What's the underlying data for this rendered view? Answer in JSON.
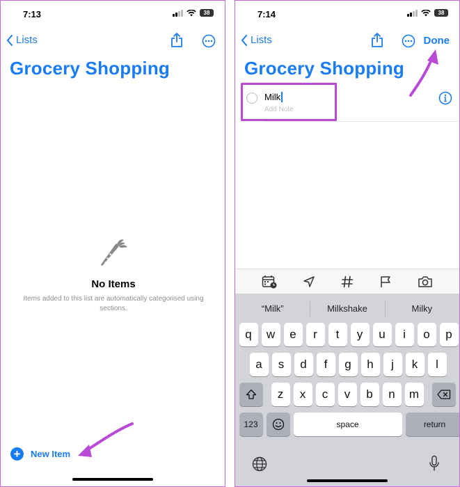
{
  "left": {
    "status_time": "7:13",
    "battery": "38",
    "back_label": "Lists",
    "title": "Grocery Shopping",
    "empty_title": "No Items",
    "empty_subtitle": "Items added to this list are automatically categorised using sections.",
    "new_item_label": "New Item",
    "icons": [
      "chevron-left-icon",
      "share-icon",
      "more-icon",
      "carrot-icon",
      "plus-icon"
    ]
  },
  "right": {
    "status_time": "7:14",
    "battery": "38",
    "back_label": "Lists",
    "done_label": "Done",
    "title": "Grocery Shopping",
    "item_text": "Milk",
    "item_note_placeholder": "Add Note",
    "toolbar_icons": [
      "calendar-clock-icon",
      "location-icon",
      "tag-icon",
      "flag-icon",
      "camera-icon"
    ],
    "suggestions": [
      "“Milk”",
      "Milkshake",
      "Milky"
    ],
    "keyboard": {
      "row1": [
        "q",
        "w",
        "e",
        "r",
        "t",
        "y",
        "u",
        "i",
        "o",
        "p"
      ],
      "row2": [
        "a",
        "s",
        "d",
        "f",
        "g",
        "h",
        "j",
        "k",
        "l"
      ],
      "row3": [
        "z",
        "x",
        "c",
        "v",
        "b",
        "n",
        "m"
      ],
      "num_label": "123",
      "space_label": "space",
      "return_label": "return"
    }
  },
  "colors": {
    "accent": "#1a7cf5",
    "annotation": "#b84ad6",
    "panel_border": "#c86bd8"
  }
}
